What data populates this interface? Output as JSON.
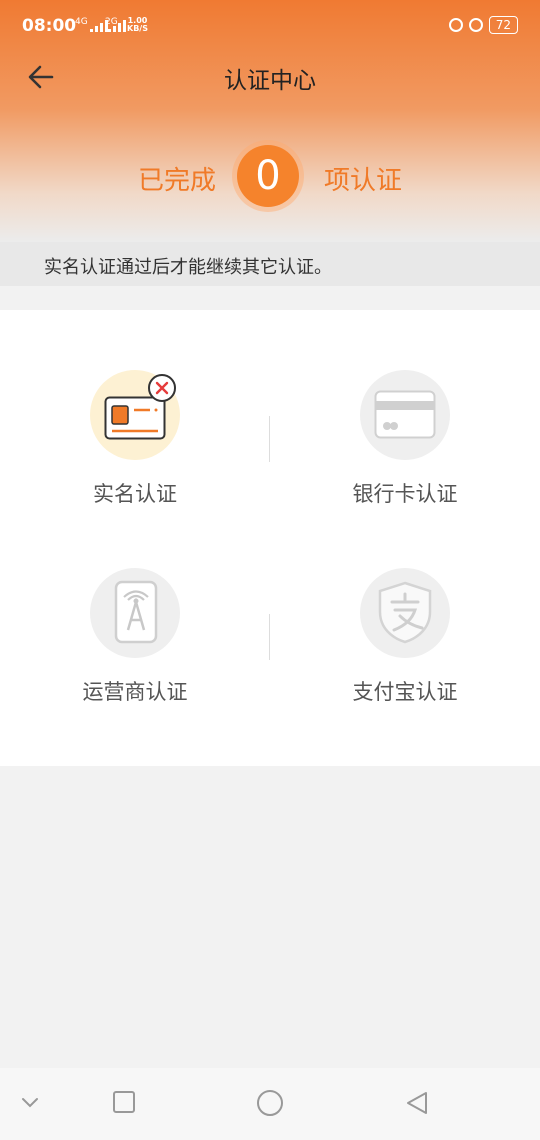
{
  "status_bar": {
    "time": "08:00",
    "network_top": "4G",
    "network_bottom": "2G",
    "speed_value": "1.00",
    "speed_unit": "KB/S",
    "battery": "72"
  },
  "header": {
    "title": "认证中心"
  },
  "summary": {
    "prefix": "已完成",
    "count": "0",
    "suffix": "项认证"
  },
  "notice": "实名认证通过后才能继续其它认证。",
  "items": [
    {
      "label": "实名认证"
    },
    {
      "label": "银行卡认证"
    },
    {
      "label": "运营商认证"
    },
    {
      "label": "支付宝认证"
    }
  ],
  "colors": {
    "accent": "#f5832c",
    "header_top": "#f07a32"
  }
}
